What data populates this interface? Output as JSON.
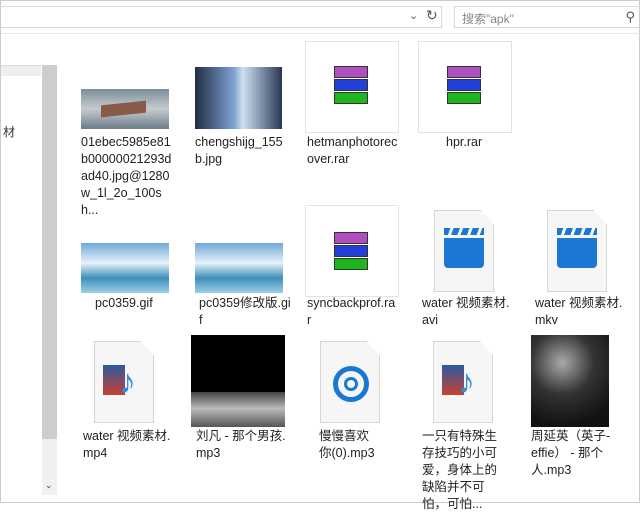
{
  "toolbar": {
    "search_placeholder": "搜索\"apk\"",
    "chevron": "⌄",
    "refresh": "↻",
    "search_icon": "⚲"
  },
  "left_pane": {
    "partial_label": "材"
  },
  "colors": {
    "rar_purple": "#b04fc0",
    "rar_blue": "#2340d8",
    "rar_green": "#1fb51f",
    "clapper_blue": "#1a78d4"
  },
  "files": [
    {
      "name": "01ebec5985e81b00000021293dad40.jpg@1280w_1l_2o_100sh...",
      "icon": "image-thumbnail"
    },
    {
      "name": "chengshijg_155b.jpg",
      "icon": "image-thumbnail"
    },
    {
      "name": "hetmanphotorecover.rar",
      "icon": "winrar-icon"
    },
    {
      "name": "hpr.rar",
      "icon": "winrar-icon"
    },
    {
      "name": "pc0359.gif",
      "icon": "image-thumbnail"
    },
    {
      "name": "pc0359修改版.gif",
      "icon": "image-thumbnail"
    },
    {
      "name": "syncbackprof.rar",
      "icon": "winrar-icon"
    },
    {
      "name": "water 视频素材.avi",
      "icon": "video-icon"
    },
    {
      "name": "water 视频素材.mkv",
      "icon": "video-icon"
    },
    {
      "name": "water 视频素材.mp4",
      "icon": "media-player-icon"
    },
    {
      "name": "刘凡 - 那个男孩.mp3",
      "icon": "album-art"
    },
    {
      "name": "慢慢喜欢你(0).mp3",
      "icon": "groove-music-icon"
    },
    {
      "name": "一只有特殊生存技巧的小可爱，身体上的缺陷并不可怕，可怕...",
      "icon": "media-player-icon"
    },
    {
      "name": "周延英（英子-effie） - 那个人.mp3",
      "icon": "album-art"
    }
  ]
}
